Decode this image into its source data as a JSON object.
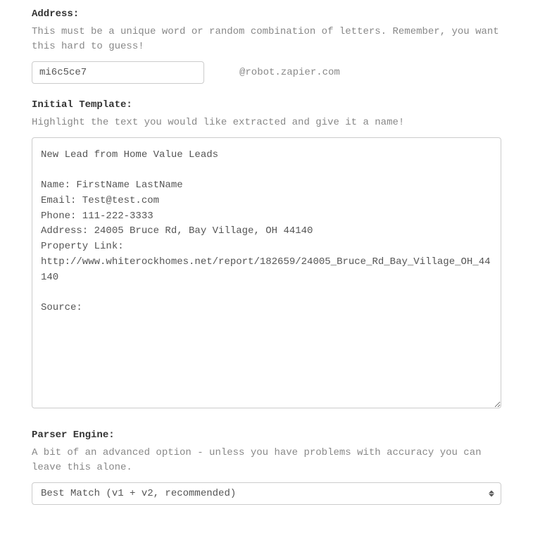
{
  "address": {
    "label": "Address:",
    "help": "This must be a unique word or random combination of letters. Remember, you want this hard to guess!",
    "value": "mi6c5ce7",
    "suffix": "@robot.zapier.com"
  },
  "template": {
    "label": "Initial Template:",
    "help": "Highlight the text you would like extracted and give it a name!",
    "value": "New Lead from Home Value Leads\n\nName: FirstName LastName\nEmail: Test@test.com\nPhone: 111-222-3333\nAddress: 24005 Bruce Rd, Bay Village, OH 44140\nProperty Link:\nhttp://www.whiterockhomes.net/report/182659/24005_Bruce_Rd_Bay_Village_OH_44140\n\nSource:"
  },
  "parser": {
    "label": "Parser Engine:",
    "help": "A bit of an advanced option - unless you have problems with accuracy you can leave this alone.",
    "selected": "Best Match (v1 + v2, recommended)"
  }
}
